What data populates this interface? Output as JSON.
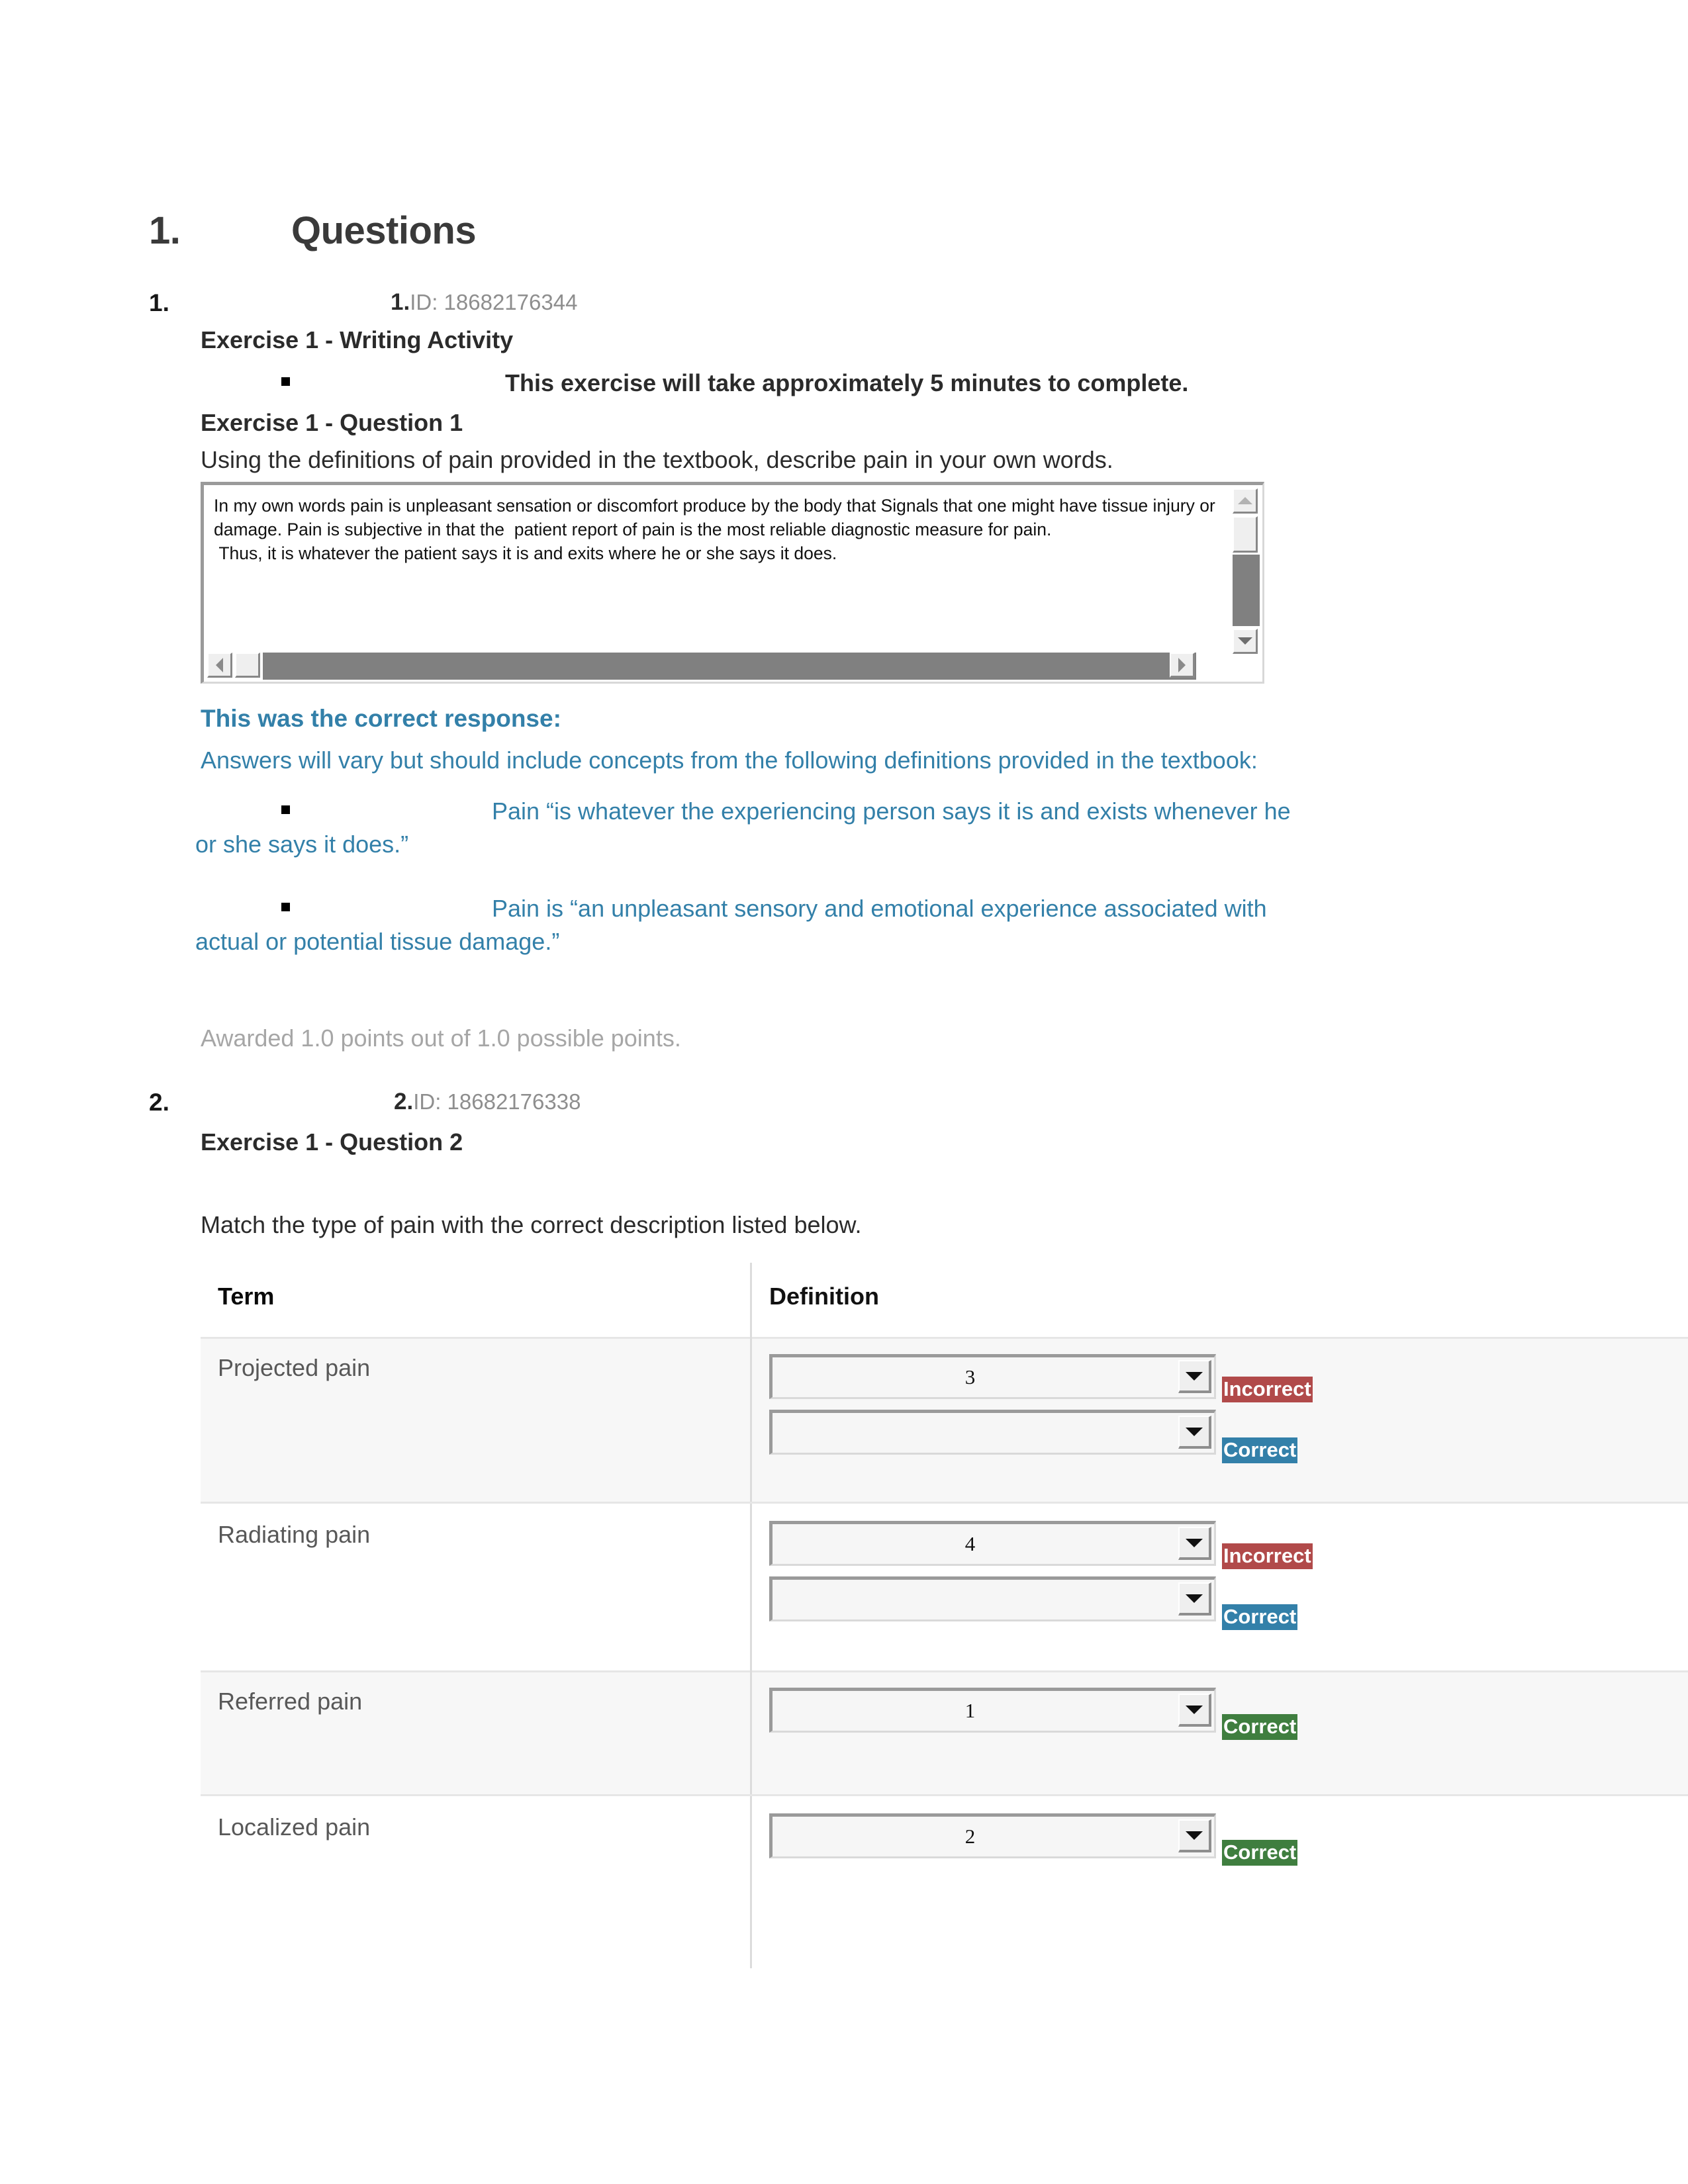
{
  "doc": {
    "heading": {
      "number": "1.",
      "text": "Questions"
    },
    "questions": [
      {
        "outer_marker": "1.",
        "inner_number": "1.",
        "id_label": "ID: 18682176344",
        "subheading_activity": "Exercise 1 - Writing Activity",
        "bullet_duration": "This exercise will take approximately 5 minutes to complete.",
        "subheading_question": "Exercise 1 - Question 1",
        "prompt": "Using the definitions of pain provided in the textbook, describe pain in your own words.",
        "answer_textarea": {
          "value": "In my own words pain is unpleasant sensation or discomfort produce by the body that Signals that one might have tissue injury or damage. Pain is subjective in that the  patient report of pain is the most reliable diagnostic measure for pain.\n Thus, it is whatever the patient says it is and exits where he or she says it does.",
          "placeholder": ""
        },
        "correct_response": {
          "heading": "This was the correct response:",
          "intro": "Answers will vary but should include concepts from the following definitions provided in the textbook:",
          "bullets": [
            {
              "lead": "Pain “is whatever the experiencing person says it is and exists whenever he",
              "cont": "or she says it does.”"
            },
            {
              "lead": "Pain is “an unpleasant sensory and emotional experience associated with",
              "cont": "actual or potential tissue damage.”"
            }
          ]
        },
        "awarded": "Awarded 1.0 points out of 1.0 possible points."
      },
      {
        "outer_marker": "2.",
        "inner_number": "2.",
        "id_label": "ID: 18682176338",
        "subheading_question": "Exercise 1 - Question 2",
        "prompt": "Match the type of pain with the correct description listed below."
      }
    ],
    "match_table": {
      "headers": [
        "Term",
        "Definition"
      ],
      "rows": [
        {
          "term": "Projected pain",
          "selects": [
            {
              "value": "3",
              "badge": "Incorrect",
              "badge_kind": "incorrect"
            },
            {
              "value": "",
              "badge": "Correct",
              "badge_kind": "correct-blue"
            }
          ]
        },
        {
          "term": "Radiating pain",
          "selects": [
            {
              "value": "4",
              "badge": "Incorrect",
              "badge_kind": "incorrect"
            },
            {
              "value": "",
              "badge": "Correct",
              "badge_kind": "correct-blue"
            }
          ]
        },
        {
          "term": "Referred pain",
          "selects": [
            {
              "value": "1",
              "badge": "Correct",
              "badge_kind": "correct-green"
            }
          ]
        },
        {
          "term": "Localized pain",
          "selects": [
            {
              "value": "2",
              "badge": "Correct",
              "badge_kind": "correct-green"
            }
          ]
        }
      ]
    },
    "icons": {
      "scroll_up": "triangle-up-icon",
      "scroll_down": "triangle-down-icon",
      "scroll_left": "triangle-left-icon",
      "scroll_right": "triangle-right-icon",
      "dropdown": "chevron-down-icon"
    },
    "colors": {
      "accent_blue": "#3380a9",
      "incorrect_red": "#b14a4a",
      "correct_green": "#3f7e3f",
      "muted_gray": "#a6a6a6",
      "body_text": "#2b2b2b",
      "row_shade": "#f7f7f7"
    }
  }
}
